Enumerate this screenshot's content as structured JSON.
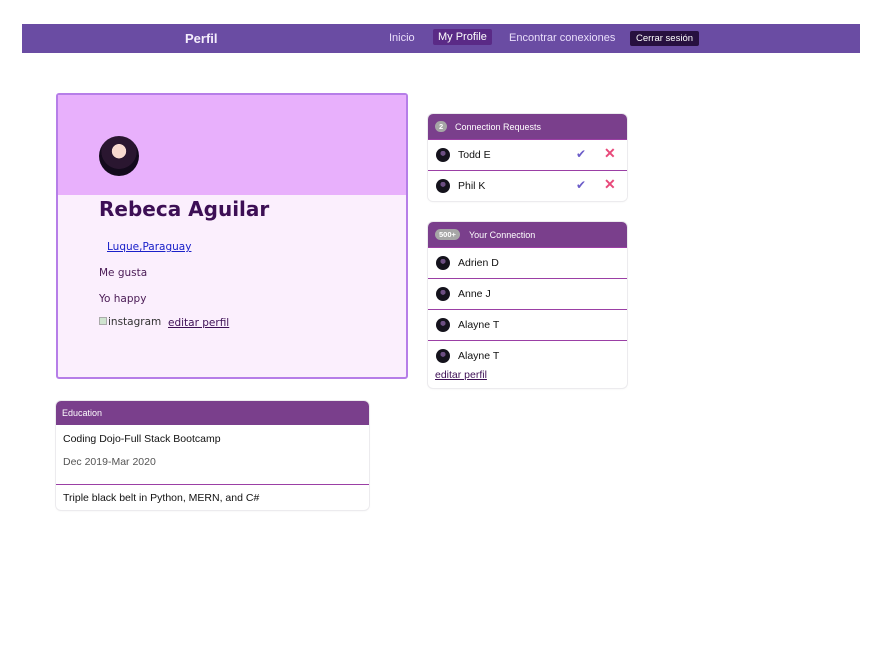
{
  "navbar": {
    "brand": "Perfil",
    "links": [
      "Inicio",
      "Encontrar conexiones"
    ],
    "active": "My Profile",
    "logout": "Cerrar sesión"
  },
  "profile": {
    "name": "Rebeca Aguilar",
    "location": "Luque,Paraguay",
    "likes": "Me gusta",
    "status": "Yo happy",
    "instagram_alt": "instagram",
    "edit_label": "editar perfil"
  },
  "requests": {
    "count": "2",
    "title": "Connection Requests",
    "items": [
      {
        "name": "Todd E"
      },
      {
        "name": "Phil K"
      }
    ]
  },
  "connections": {
    "count": "500+",
    "title": "Your Connection",
    "items": [
      {
        "name": "Adrien D"
      },
      {
        "name": "Anne J"
      },
      {
        "name": "Alayne T"
      },
      {
        "name": "Alayne T"
      }
    ],
    "edit_label": "editar perfil"
  },
  "education": {
    "title": "Education",
    "items": [
      {
        "title": "Coding Dojo-Full Stack Bootcamp",
        "date": "Dec 2019-Mar 2020"
      },
      {
        "title": "Triple black belt in Python, MERN, and C#"
      }
    ]
  },
  "icons": {
    "accept": "check-icon",
    "reject": "x-icon"
  },
  "colors": {
    "navbar": "#6a4ca3",
    "card_header": "#7a3f8c",
    "profile_cover": "#e8b0fc",
    "profile_border": "#b67ee8"
  }
}
